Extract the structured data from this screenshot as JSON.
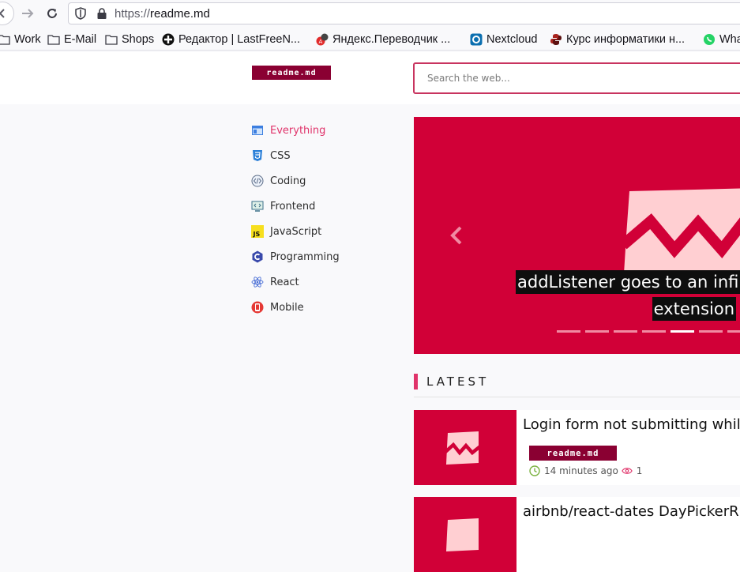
{
  "browser": {
    "url_scheme": "https://",
    "url_host": "readme.md",
    "bookmarks": [
      {
        "label": "Work",
        "icon": "folder-icon"
      },
      {
        "label": "E-Mail",
        "icon": "folder-icon"
      },
      {
        "label": "Shops",
        "icon": "folder-icon"
      },
      {
        "label": "Редактор | LastFreeN...",
        "icon": "lastfree-icon"
      },
      {
        "label": "Яндекс.Переводчик ...",
        "icon": "yandex-translate-icon"
      },
      {
        "label": "Nextcloud",
        "icon": "nextcloud-icon"
      },
      {
        "label": "Курс информатики н...",
        "icon": "python-icon"
      },
      {
        "label": "Wha",
        "icon": "whatsapp-icon"
      }
    ]
  },
  "header": {
    "logo_text": "readme.md",
    "search_placeholder": "Search the web..."
  },
  "sidebar": {
    "items": [
      {
        "label": "Everything",
        "icon": "layout-icon",
        "active": true
      },
      {
        "label": "CSS",
        "icon": "css3-icon"
      },
      {
        "label": "Coding",
        "icon": "code-icon"
      },
      {
        "label": "Frontend",
        "icon": "monitor-code-icon"
      },
      {
        "label": "JavaScript",
        "icon": "js-icon"
      },
      {
        "label": "Programming",
        "icon": "c-lang-icon"
      },
      {
        "label": "React",
        "icon": "react-icon"
      },
      {
        "label": "Mobile",
        "icon": "mobile-icon"
      }
    ]
  },
  "hero": {
    "caption_line1": "addListener goes to an infin",
    "caption_line2": "extension",
    "slides_count": 7,
    "active_slide": 5
  },
  "latest": {
    "heading": "LATEST",
    "posts": [
      {
        "title": "Login form not submitting whil",
        "tag": "readme.md",
        "time": "14 minutes ago",
        "views": "1"
      },
      {
        "title": "airbnb/react-dates DayPickerR",
        "tag": "",
        "time": "",
        "views": ""
      }
    ]
  },
  "colors": {
    "brand": "#d10037",
    "tag_bg": "#8a0032",
    "accent": "#e0336a"
  }
}
